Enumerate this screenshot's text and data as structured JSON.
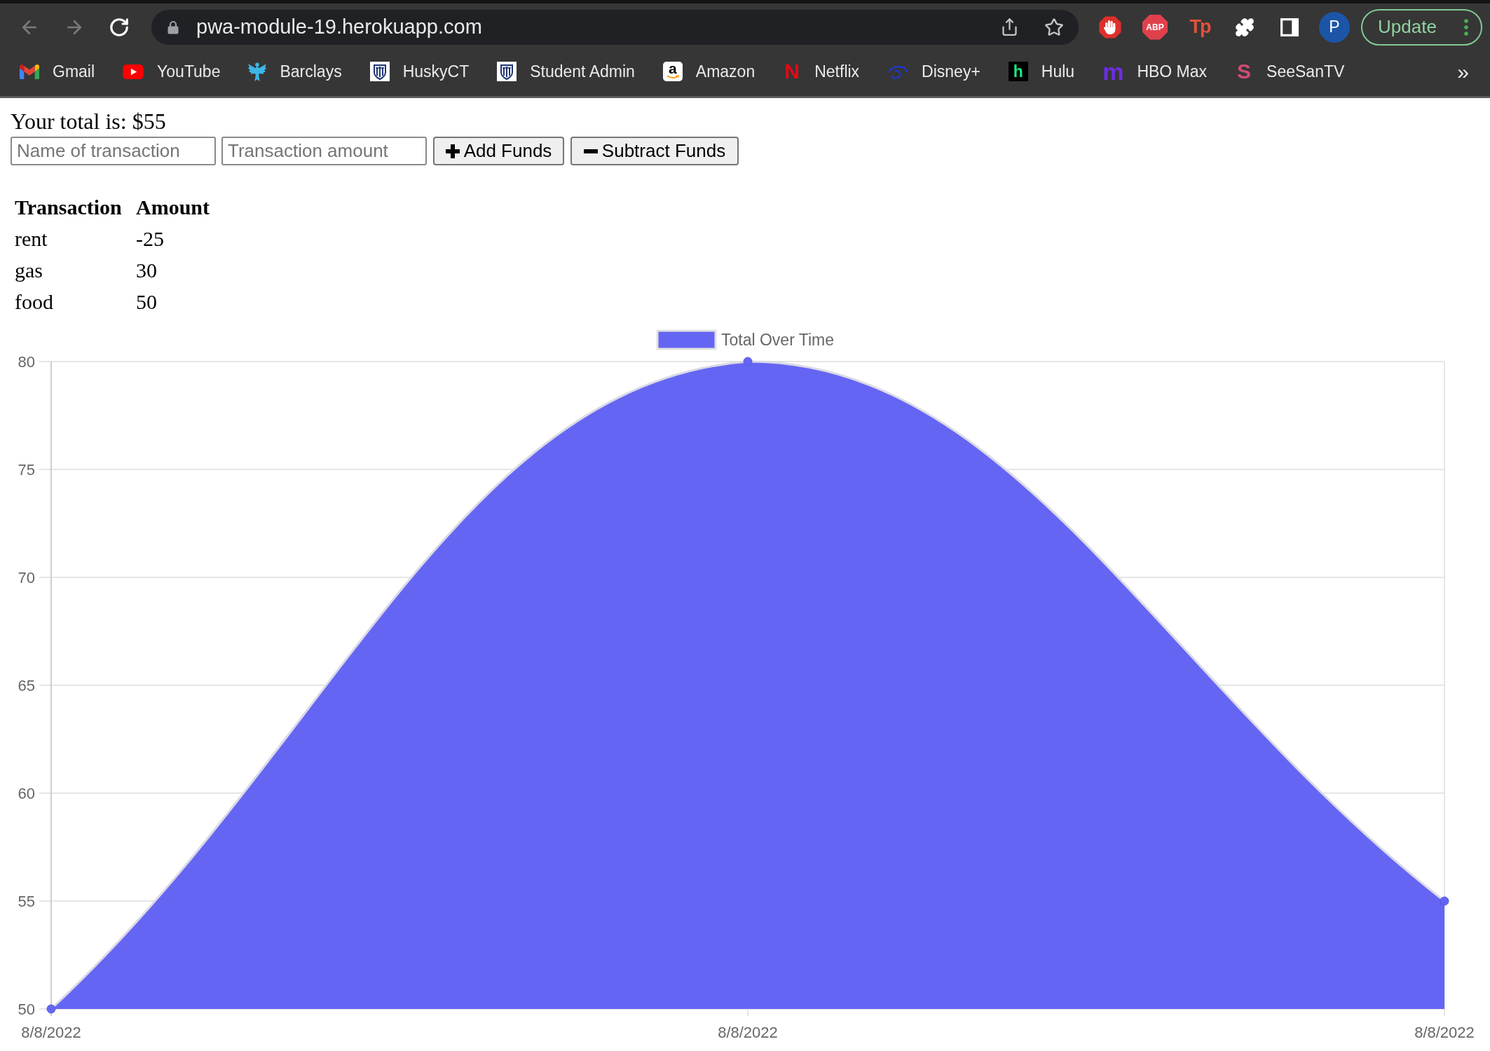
{
  "chrome": {
    "navigation": {
      "back_disabled": true,
      "forward_disabled": true
    },
    "url": "pwa-module-19.herokuapp.com",
    "extensions": [
      {
        "kind": "hand"
      },
      {
        "kind": "octagon-text",
        "text": "ABP"
      },
      {
        "kind": "red-text",
        "text": "Tp"
      },
      {
        "kind": "puzzle"
      },
      {
        "kind": "side-panel"
      }
    ],
    "profile_initial": "P",
    "update_button": "Update"
  },
  "bookmarks": {
    "items": [
      {
        "label": "Gmail",
        "kind": "mail"
      },
      {
        "label": "YouTube",
        "kind": "play"
      },
      {
        "label": "Barclays",
        "kind": "eagle"
      },
      {
        "label": "HuskyCT",
        "kind": "crest"
      },
      {
        "label": "Student Admin",
        "kind": "crest"
      },
      {
        "label": "Amazon",
        "kind": "smile-tile",
        "logo_text": "a"
      },
      {
        "label": "Netflix",
        "kind": "red-letter",
        "logo_text": "N"
      },
      {
        "label": "Disney+",
        "kind": "arc"
      },
      {
        "label": "Hulu",
        "kind": "dark-tile",
        "logo_text": "h"
      },
      {
        "label": "HBO Max",
        "kind": "purple-letter",
        "logo_text": "m"
      },
      {
        "label": "SeeSanTV",
        "kind": "pink-letter",
        "logo_text": "S"
      }
    ],
    "overflow": "»"
  },
  "page": {
    "total_text": "Your total is: $55",
    "inputs": [
      {
        "placeholder": "Name of transaction"
      },
      {
        "placeholder": "Transaction amount"
      }
    ],
    "buttons": [
      {
        "kind": "add",
        "label": "Add Funds"
      },
      {
        "kind": "subtract",
        "label": "Subtract Funds"
      }
    ],
    "table": {
      "columns": [
        "Transaction",
        "Amount"
      ],
      "rows": [
        [
          "rent",
          "-25"
        ],
        [
          "gas",
          "30"
        ],
        [
          "food",
          "50"
        ]
      ]
    }
  },
  "chart": {
    "chart_data": {
      "type": "area",
      "categories": [
        "8/8/2022",
        "8/8/2022",
        "8/8/2022"
      ],
      "series": [
        {
          "name": "Total Over Time",
          "color": "#6565f4",
          "values": [
            50,
            80,
            55
          ]
        }
      ],
      "ylim": [
        50,
        80
      ],
      "yticks": [
        50,
        55,
        60,
        65,
        70,
        75,
        80
      ],
      "grid": true
    }
  }
}
